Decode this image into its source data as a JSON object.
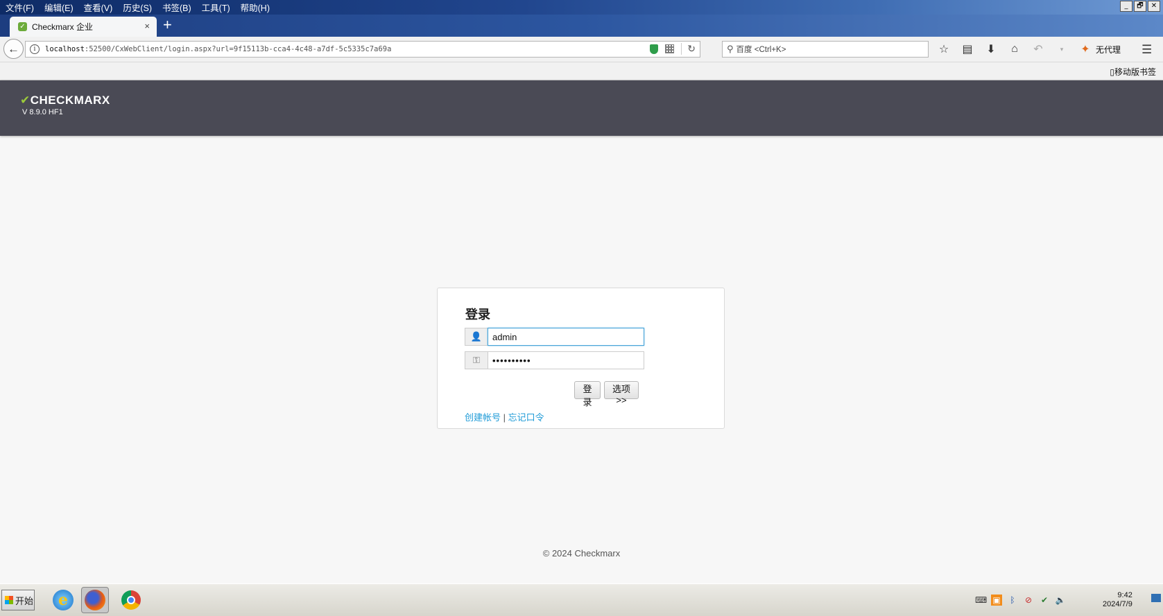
{
  "menubar": {
    "items": [
      "文件(F)",
      "编辑(E)",
      "查看(V)",
      "历史(S)",
      "书签(B)",
      "工具(T)",
      "帮助(H)"
    ],
    "window_controls": [
      "_",
      "🗗",
      "✕"
    ]
  },
  "tabs": [
    {
      "title": "Checkmarx 企业",
      "close": "×",
      "favicon": "checkmarx-favicon"
    }
  ],
  "new_tab_label": "+",
  "navbar": {
    "back": "back-arrow-icon",
    "url_host": "localhost",
    "url_path": ":52500/CxWebClient/login.aspx?url=9f15113b-cca4-4c48-a7df-5c5335c7a69a",
    "search_placeholder": "百度 <Ctrl+K>",
    "proxy_label": "无代理"
  },
  "bookmarks": {
    "mobile_label": "移动版书签"
  },
  "header": {
    "logo_check": "✔",
    "logo_text": "CHECKMARX",
    "version": "V 8.9.0 HF1",
    "background": "#4a4a55",
    "accent": "#9ccb3b"
  },
  "login": {
    "title": "登录",
    "username_value": "admin",
    "password_value": "••••••••••",
    "login_button": "登录",
    "options_button": "选项>>",
    "create_account": "创建帐号",
    "separator": "|",
    "forgot_password": "忘记口令",
    "link_color": "#1f9bd7"
  },
  "footer": {
    "copyright": "© 2024 Checkmarx"
  },
  "taskbar": {
    "start_label": "开始",
    "apps": [
      "internet-explorer-icon",
      "firefox-icon",
      "chrome-icon"
    ],
    "clock_time": "9:42",
    "clock_date": "2024/7/9"
  }
}
